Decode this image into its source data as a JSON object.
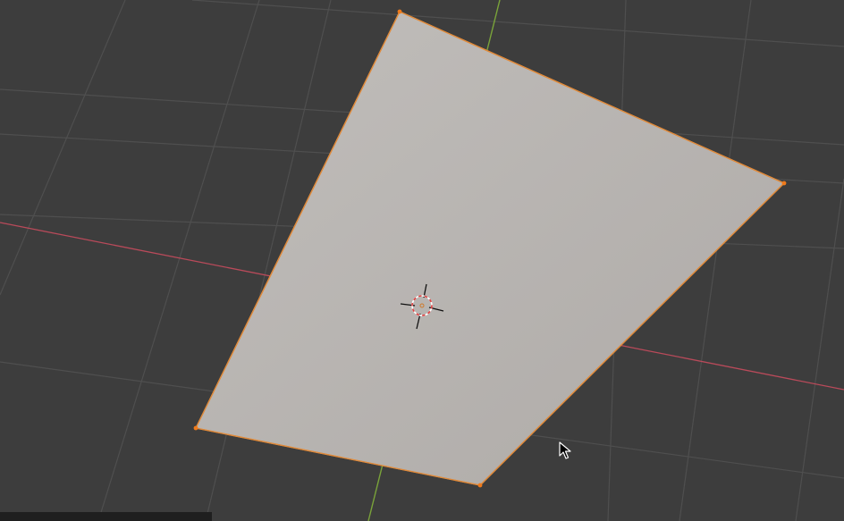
{
  "viewport": {
    "background": "#3d3d3d",
    "grid_color": "#4f4f4f",
    "x_axis_color": "#b94a5a",
    "y_axis_color": "#7aa33a"
  },
  "mesh": {
    "type": "plane",
    "mode": "edit-mode",
    "face_color": "#b8b4b1",
    "edge_color": "#e08a3a",
    "vertex_color": "#f07a1a",
    "vertex_count": 4,
    "selection": "all-selected"
  },
  "cursor_3d": {
    "icon": "3d-cursor-icon",
    "ring_colors": [
      "#e04040",
      "#ffffff"
    ]
  },
  "mouse": {
    "icon": "mouse-pointer-icon"
  },
  "status_strip": {
    "color": "#1f1f1f"
  }
}
